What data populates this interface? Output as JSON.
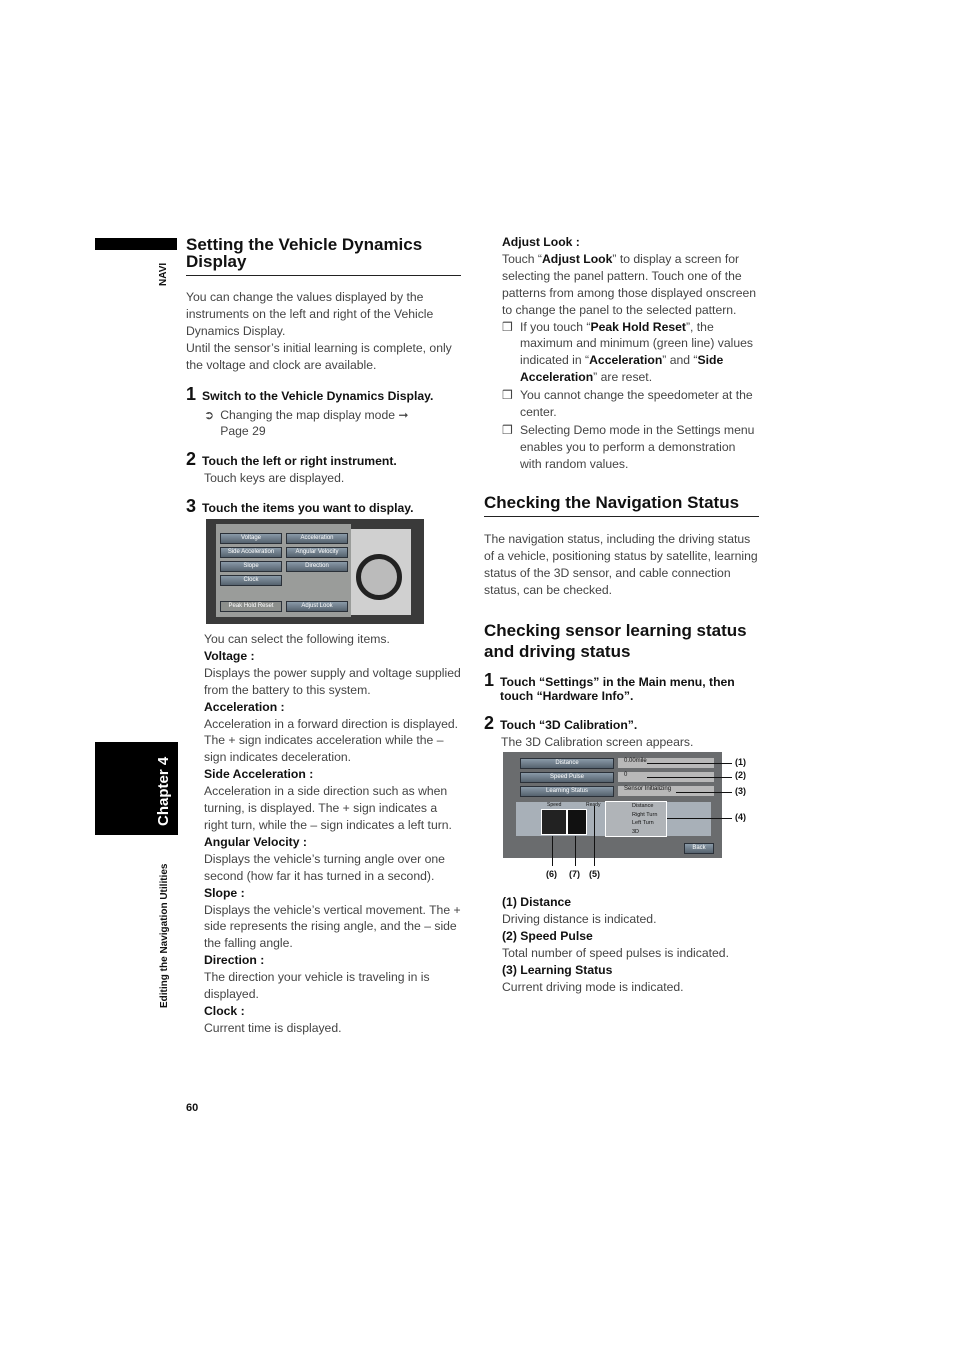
{
  "side": {
    "navi": "NAVI",
    "chapter": "Chapter 4",
    "section": "Editing the Navigation Utilities",
    "page_number": "60"
  },
  "left": {
    "title": "Setting the Vehicle Dynamics Display",
    "intro": [
      "You can change the values displayed by the instruments on the left and right of the Vehicle Dynamics Display.",
      "Until the sensor’s initial learning is complete, only the voltage and clock are available."
    ],
    "steps": [
      {
        "num": "1",
        "text": "Switch to the Vehicle Dynamics Display.",
        "sub": "Changing the map display mode ➞ Page 29"
      },
      {
        "num": "2",
        "text": "Touch the left or right instrument.",
        "sub": "Touch keys are displayed."
      },
      {
        "num": "3",
        "text": "Touch the items you want to display."
      }
    ],
    "screen": {
      "buttons": [
        "Voltage",
        "Acceleration",
        "Side Acceleration",
        "Angular Velocity",
        "Slope",
        "Direction",
        "Clock",
        "Peak Hold Reset",
        "Adjust Look"
      ]
    },
    "select_text": "You can select the following items.",
    "items": [
      {
        "term": "Voltage :",
        "desc": "Displays the power supply and voltage supplied from the battery to this system."
      },
      {
        "term": "Acceleration :",
        "desc": "Acceleration in a forward direction is displayed. The + sign indicates acceleration while the – sign indicates deceleration."
      },
      {
        "term": "Side Acceleration :",
        "desc": "Acceleration in a side direction such as when turning, is displayed. The + sign indicates a right turn, while the – sign indicates a left turn."
      },
      {
        "term": "Angular Velocity :",
        "desc": "Displays the vehicle’s turning angle over one second (how far it has turned in a second)."
      },
      {
        "term": "Slope :",
        "desc": "Displays the vehicle’s vertical movement. The + side represents the rising angle, and the – side the falling angle."
      },
      {
        "term": "Direction :",
        "desc": "The direction your vehicle is traveling in is displayed."
      },
      {
        "term": "Clock :",
        "desc": "Current time is displayed."
      }
    ]
  },
  "right": {
    "adjust_term": "Adjust Look :",
    "adjust_desc": {
      "a": "Touch “",
      "b": "Adjust Look",
      "c": "” to display a screen for selecting the panel pattern. Touch one of the patterns from among those displayed onscreen to change the panel to the selected pattern."
    },
    "bullet1": {
      "a": "If you touch “",
      "b": "Peak Hold Reset",
      "c": "”, the maximum and minimum (green line) values indicated in “",
      "d": "Acceleration",
      "e": "” and “",
      "f": "Side Acceleration",
      "g": "” are reset."
    },
    "bullet2": "You cannot change the speedometer at the center.",
    "bullet3": "Selecting Demo mode in the Settings menu enables you to perform a demonstration with random values.",
    "title2": "Checking the Navigation Status",
    "intro2": "The navigation status, including the driving status of a vehicle, positioning status by satellite, learning status of the 3D sensor, and cable connection status, can be checked.",
    "title3": "Checking sensor learning status and driving status",
    "steps": [
      {
        "num": "1",
        "text": "Touch “Settings” in the Main menu, then touch “Hardware Info”."
      },
      {
        "num": "2",
        "text": "Touch “3D Calibration”.",
        "sub": "The 3D Calibration screen appears."
      }
    ],
    "screen": {
      "rows": [
        {
          "label": "Distance",
          "value": "0.00mile"
        },
        {
          "label": "Speed Pulse",
          "value": "0"
        },
        {
          "label": "Learning Status",
          "value": "Sensor Initializing"
        }
      ],
      "panel": [
        "Distance",
        "Right Turn",
        "Left Turn",
        "3D"
      ],
      "speed": "Speed",
      "ready": "Ready",
      "back": "Back",
      "callouts": [
        "(1)",
        "(2)",
        "(3)",
        "(4)",
        "(6)",
        "(7)",
        "(5)"
      ]
    },
    "defs": [
      {
        "term": "(1) Distance",
        "desc": "Driving distance is indicated."
      },
      {
        "term": "(2) Speed Pulse",
        "desc": "Total number of speed pulses is indicated."
      },
      {
        "term": "(3) Learning Status",
        "desc": "Current driving mode is indicated."
      }
    ]
  }
}
